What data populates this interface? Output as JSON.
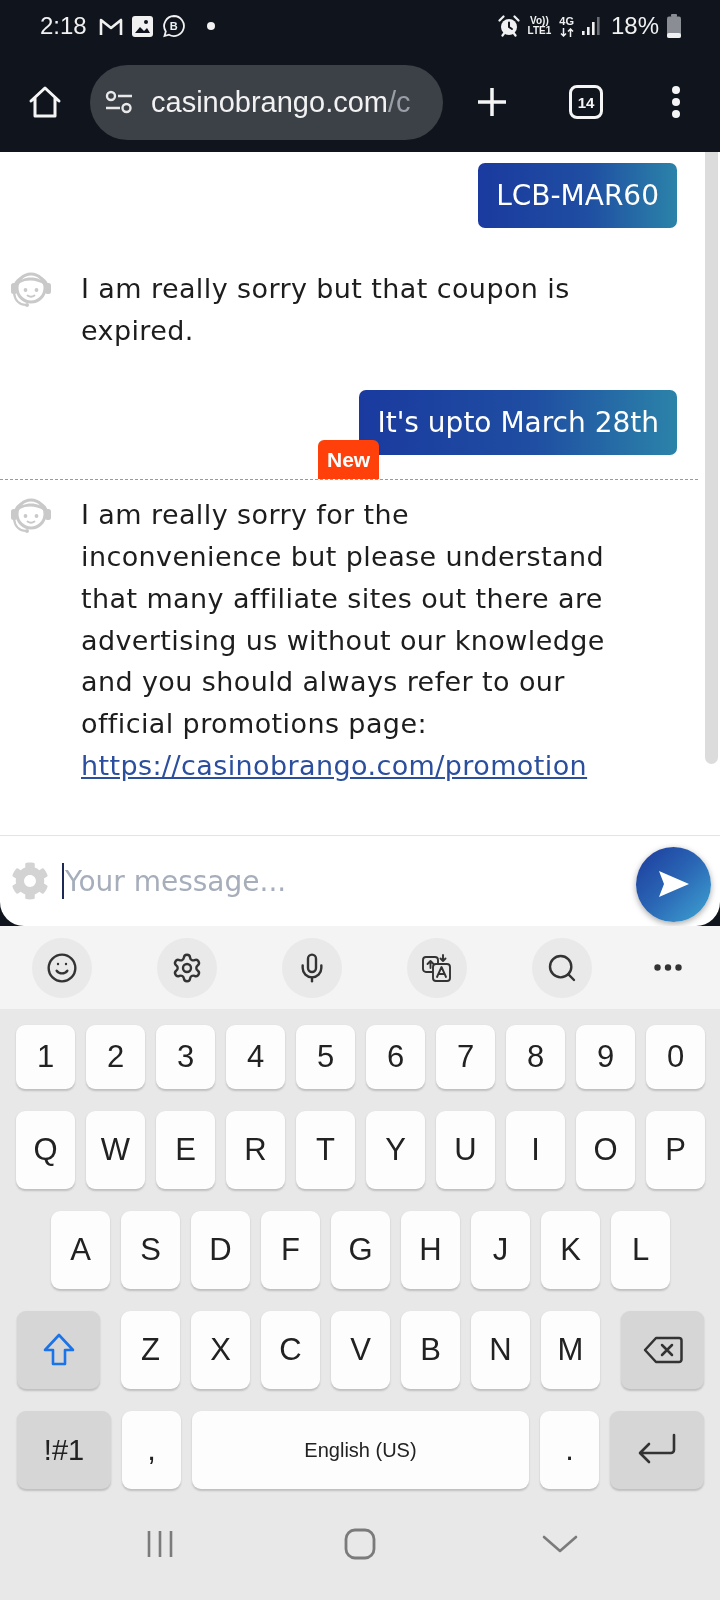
{
  "status_bar": {
    "time": "2:18",
    "notification_icons": [
      {
        "kind": "mail"
      },
      {
        "kind": "image"
      },
      {
        "kind": "chat",
        "letter": "B"
      },
      {
        "kind": "dot"
      }
    ],
    "volte": [
      "Vo))",
      "LTE1"
    ],
    "network": "4G",
    "battery": "18%"
  },
  "browser": {
    "url_host": "casinobrango.com",
    "url_path": "/c",
    "tab_count": "14"
  },
  "chat": {
    "messages": [
      {
        "kind": "user",
        "text": "LCB-MAR60"
      },
      {
        "kind": "agent",
        "lines": [
          "I am really sorry but that coupon is",
          "expired."
        ]
      },
      {
        "kind": "user",
        "text": "It's upto March 28th"
      },
      {
        "kind": "divider",
        "badge": "New"
      },
      {
        "kind": "agent",
        "lines": [
          "I am really sorry for the",
          "inconvenience but please understand",
          "that many affiliate sites out there are",
          "advertising us without our knowledge",
          "and you should always refer to our",
          "official promotions page:"
        ],
        "link": "https://casinobrango.com/promotion"
      }
    ],
    "input": {
      "placeholder": "Your message..."
    }
  },
  "keyboard": {
    "toolbar": [
      {
        "kind": "emoji"
      },
      {
        "kind": "settings"
      },
      {
        "kind": "voice"
      },
      {
        "kind": "translate"
      },
      {
        "kind": "search"
      },
      {
        "kind": "more"
      }
    ],
    "rows": [
      {
        "kind": "number",
        "keys": [
          {
            "kind": "char",
            "label": "1"
          },
          {
            "kind": "char",
            "label": "2"
          },
          {
            "kind": "char",
            "label": "3"
          },
          {
            "kind": "char",
            "label": "4"
          },
          {
            "kind": "char",
            "label": "5"
          },
          {
            "kind": "char",
            "label": "6"
          },
          {
            "kind": "char",
            "label": "7"
          },
          {
            "kind": "char",
            "label": "8"
          },
          {
            "kind": "char",
            "label": "9"
          },
          {
            "kind": "char",
            "label": "0"
          }
        ]
      },
      {
        "kind": "letter",
        "keys": [
          {
            "kind": "char",
            "label": "Q"
          },
          {
            "kind": "char",
            "label": "W"
          },
          {
            "kind": "char",
            "label": "E"
          },
          {
            "kind": "char",
            "label": "R"
          },
          {
            "kind": "char",
            "label": "T"
          },
          {
            "kind": "char",
            "label": "Y"
          },
          {
            "kind": "char",
            "label": "U"
          },
          {
            "kind": "char",
            "label": "I"
          },
          {
            "kind": "char",
            "label": "O"
          },
          {
            "kind": "char",
            "label": "P"
          }
        ]
      },
      {
        "kind": "letter",
        "keys": [
          {
            "kind": "char",
            "label": "A"
          },
          {
            "kind": "char",
            "label": "S"
          },
          {
            "kind": "char",
            "label": "D"
          },
          {
            "kind": "char",
            "label": "F"
          },
          {
            "kind": "char",
            "label": "G"
          },
          {
            "kind": "char",
            "label": "H"
          },
          {
            "kind": "char",
            "label": "J"
          },
          {
            "kind": "char",
            "label": "K"
          },
          {
            "kind": "char",
            "label": "L"
          }
        ]
      },
      {
        "kind": "letter",
        "keys": [
          {
            "kind": "shift",
            "on": true
          },
          {
            "kind": "char",
            "label": "Z"
          },
          {
            "kind": "char",
            "label": "X"
          },
          {
            "kind": "char",
            "label": "C"
          },
          {
            "kind": "char",
            "label": "V"
          },
          {
            "kind": "char",
            "label": "B"
          },
          {
            "kind": "char",
            "label": "N"
          },
          {
            "kind": "char",
            "label": "M"
          },
          {
            "kind": "backspace"
          }
        ]
      },
      {
        "kind": "letter",
        "keys": [
          {
            "kind": "symbols",
            "label": "!#1"
          },
          {
            "kind": "char",
            "label": ","
          },
          {
            "kind": "space",
            "label": "English (US)"
          },
          {
            "kind": "char",
            "label": "."
          },
          {
            "kind": "enter"
          }
        ]
      }
    ]
  },
  "nav_bar": [
    {
      "kind": "recents"
    },
    {
      "kind": "home"
    },
    {
      "kind": "back"
    }
  ]
}
